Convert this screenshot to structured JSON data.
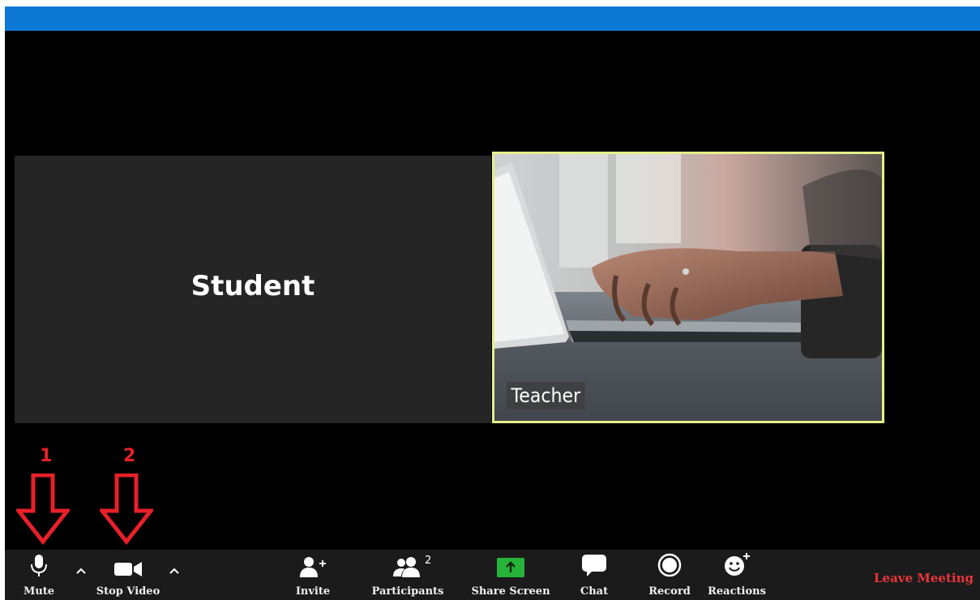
{
  "meeting": {
    "participants": {
      "student": {
        "name": "Student"
      },
      "teacher": {
        "name": "Teacher"
      }
    }
  },
  "annotations": [
    {
      "number": "1",
      "color": "#e8202a"
    },
    {
      "number": "2",
      "color": "#e8202a"
    }
  ],
  "toolbar": {
    "mute_label": "Mute",
    "stop_video_label": "Stop Video",
    "invite_label": "Invite",
    "participants_label": "Participants",
    "participants_count": "2",
    "share_screen_label": "Share Screen",
    "chat_label": "Chat",
    "record_label": "Record",
    "reactions_label": "Reactions",
    "leave_label": "Leave Meeting"
  },
  "colors": {
    "titlebar": "#0b78d4",
    "active_speaker_border": "#e5ef8a",
    "share_green": "#26b33a",
    "leave_red": "#e8363a"
  }
}
